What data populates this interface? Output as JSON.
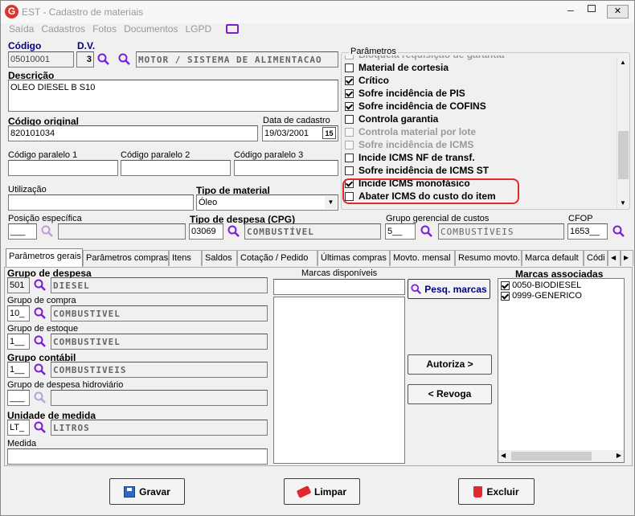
{
  "window": {
    "title": "EST - Cadastro de materiais",
    "icon_letter": "G",
    "close": "✕"
  },
  "menu": [
    "Saída",
    "Cadastros",
    "Fotos",
    "Documentos",
    "LGPD"
  ],
  "header": {
    "codigo_label": "Código",
    "codigo": "05010001",
    "dv_label": "D.V.",
    "dv": "3",
    "grupo_desc": "MOTOR / SISTEMA DE ALIMENTACAO",
    "descricao_label": "Descrição",
    "descricao": "OLEO DIESEL B S10",
    "codigo_original_label": "Código original",
    "codigo_original": "820101034",
    "data_cadastro_label": "Data de cadastro",
    "data_cadastro": "19/03/2001",
    "cal_icon": "15",
    "paralelo1_label": "Código paralelo 1",
    "paralelo2_label": "Código paralelo 2",
    "paralelo3_label": "Código paralelo 3",
    "utilizacao_label": "Utilização",
    "tipo_material_label": "Tipo de material",
    "tipo_material": "Óleo",
    "posicao_label": "Posição específica",
    "posicao": "___",
    "tipo_despesa_label": "Tipo de despesa (CPG)",
    "tipo_despesa_code": "03069",
    "tipo_despesa_desc": "COMBUSTÍVEL",
    "grupo_gerencial_label": "Grupo gerencial de custos",
    "grupo_gerencial_code": "5__",
    "grupo_gerencial_desc": "COMBUSTÍVEIS",
    "cfop_label": "CFOP",
    "cfop": "1653__"
  },
  "parametros": {
    "label": "Parâmetros",
    "items": [
      {
        "text": "Bloqueia requisição de garantia",
        "checked": false,
        "disabled": true
      },
      {
        "text": "Material de cortesia",
        "checked": false,
        "disabled": false
      },
      {
        "text": "Crítico",
        "checked": true,
        "disabled": false
      },
      {
        "text": "Sofre incidência de PIS",
        "checked": true,
        "disabled": false
      },
      {
        "text": "Sofre incidência de COFINS",
        "checked": true,
        "disabled": false
      },
      {
        "text": "Controla garantia",
        "checked": false,
        "disabled": false
      },
      {
        "text": "Controla material por lote",
        "checked": false,
        "disabled": true
      },
      {
        "text": "Sofre incidência de ICMS",
        "checked": false,
        "disabled": true
      },
      {
        "text": "Incide ICMS NF de transf.",
        "checked": false,
        "disabled": false
      },
      {
        "text": "Sofre incidência de ICMS ST",
        "checked": false,
        "disabled": false
      },
      {
        "text": "Incide ICMS monofásico",
        "checked": true,
        "disabled": false
      },
      {
        "text": "Abater ICMS do custo do item",
        "checked": false,
        "disabled": false
      }
    ]
  },
  "tabs": [
    "Parâmetros gerais",
    "Parâmetros compras",
    "Itens",
    "Saldos",
    "Cotação / Pedido",
    "Últimas compras",
    "Movto. mensal",
    "Resumo movto.",
    "Marca default",
    "Códi"
  ],
  "gerais": {
    "grupo_despesa_label": "Grupo de despesa",
    "grupo_despesa_code": "501",
    "grupo_despesa_desc": "DIESEL",
    "grupo_compra_label": "Grupo de compra",
    "grupo_compra_code": "10_",
    "grupo_compra_desc": "COMBUSTIVEL",
    "grupo_estoque_label": "Grupo de estoque",
    "grupo_estoque_code": "1__",
    "grupo_estoque_desc": "COMBUSTIVEL",
    "grupo_contabil_label": "Grupo contábil",
    "grupo_contabil_code": "1__",
    "grupo_contabil_desc": "COMBUSTIVEIS",
    "grupo_hidro_label": "Grupo de despesa hidroviário",
    "grupo_hidro_code": "___",
    "unidade_label": "Unidade de medida",
    "unidade_code": "LT_",
    "unidade_desc": "LITROS",
    "medida_label": "Medida"
  },
  "marcas": {
    "disponiveis_label": "Marcas disponíveis",
    "pesq_label": "Pesq. marcas",
    "autoriza_label": "Autoriza >",
    "revoga_label": "< Revoga",
    "associadas_label": "Marcas associadas",
    "associadas": [
      "0050-BIODIESEL",
      "0999-GENERICO"
    ]
  },
  "footer": {
    "gravar": "Gravar",
    "limpar": "Limpar",
    "excluir": "Excluir"
  },
  "colors": {
    "accent": "#7a1fd6",
    "highlight": "#e0282e",
    "magnifier": "#7a1fd6"
  }
}
